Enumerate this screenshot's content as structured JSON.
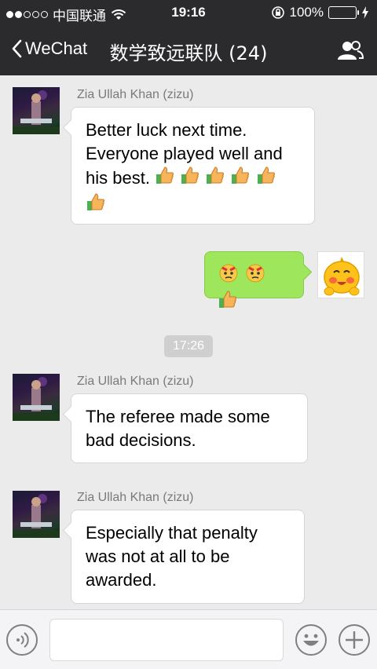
{
  "status_bar": {
    "carrier": "中国联通",
    "time": "19:16",
    "battery_percent": "100%",
    "battery_level": 1.0
  },
  "nav": {
    "back_label": "WeChat",
    "title": "数学致远联队 (24)"
  },
  "messages": [
    {
      "sender": "Zia Ullah Khan (zizu)",
      "lines": [
        "Better luck next time.",
        "Everyone played well and",
        "his best."
      ],
      "emojis": [
        "thumbs-up",
        "thumbs-up",
        "thumbs-up",
        "thumbs-up",
        "thumbs-up",
        "thumbs-up"
      ]
    },
    {
      "sender": "me",
      "emojis": [
        "angry-face",
        "angry-face",
        "thumbs-up"
      ]
    },
    {
      "sender": "Zia Ullah Khan (zizu)",
      "lines": [
        "The referee made some",
        "bad decisions."
      ]
    },
    {
      "sender": "Zia Ullah Khan (zizu)",
      "lines": [
        "Especially that penalty",
        "was not at all to be",
        "awarded."
      ]
    }
  ],
  "timestamp": "17:26",
  "input": {
    "value": "",
    "placeholder": ""
  },
  "colors": {
    "nav_bg": "#2b2b2e",
    "chat_bg": "#ebebeb",
    "my_bubble": "#9ee65c",
    "battery_fill": "#4cd964"
  },
  "icons": [
    "wifi-icon",
    "lock-rotation-icon",
    "charging-icon",
    "back-chevron-icon",
    "group-members-icon",
    "voice-icon",
    "emoji-icon",
    "add-icon"
  ]
}
